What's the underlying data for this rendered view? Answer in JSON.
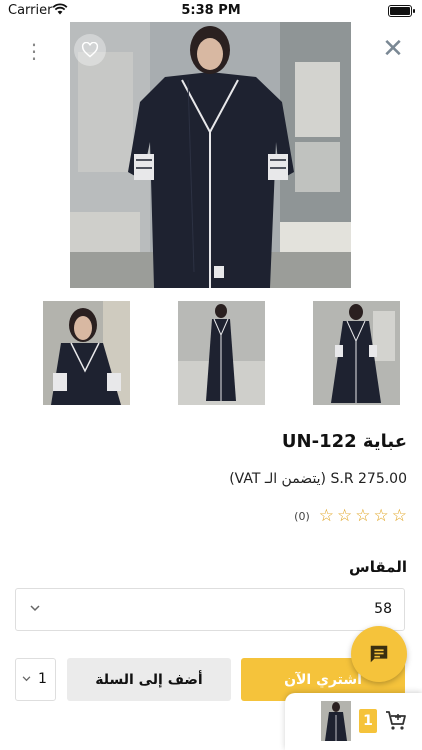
{
  "status_bar": {
    "carrier": "Carrier",
    "time": "5:38 PM"
  },
  "product": {
    "title": "عباية UN-122",
    "price": "S.R 275.00 (يتضمن الـ VAT)",
    "rating": {
      "stars": 0,
      "max": 5,
      "count": "(0)"
    }
  },
  "size": {
    "label": "المقاس",
    "selected": "58"
  },
  "quantity": {
    "selected": "1"
  },
  "buttons": {
    "add_to_cart": "أضف إلى السلة",
    "buy_now": "اشتري الآن"
  },
  "mini_cart": {
    "count": "1"
  },
  "colors": {
    "accent": "#f5c33b",
    "star": "#e0a21c",
    "abaya": "#1e2230",
    "trim": "#e8e8ea"
  },
  "icons": [
    "wifi-icon",
    "battery-icon",
    "more-vertical-icon",
    "close-icon",
    "heart-icon",
    "star-icon",
    "chevron-down-icon",
    "chat-icon",
    "cart-icon"
  ]
}
